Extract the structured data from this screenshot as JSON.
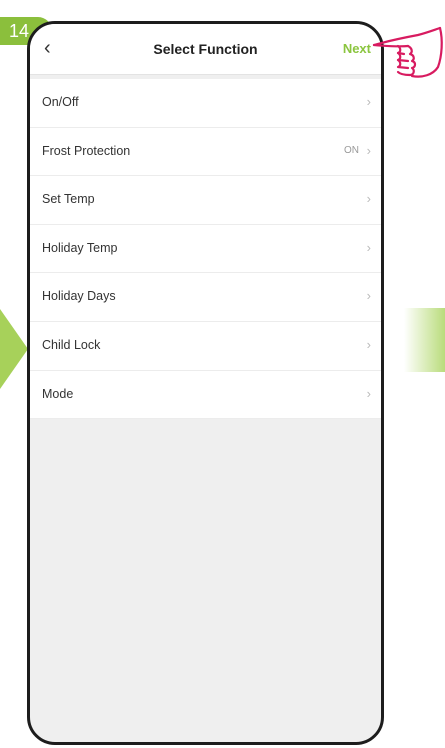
{
  "step_badge": "14",
  "header": {
    "title": "Select Function",
    "next_label": "Next"
  },
  "functions": [
    {
      "label": "On/Off",
      "value": ""
    },
    {
      "label": "Frost Protection",
      "value": "ON"
    },
    {
      "label": "Set Temp",
      "value": ""
    },
    {
      "label": "Holiday Temp",
      "value": ""
    },
    {
      "label": "Holiday Days",
      "value": ""
    },
    {
      "label": "Child Lock",
      "value": ""
    },
    {
      "label": "Mode",
      "value": ""
    }
  ],
  "colors": {
    "accent_green": "#8bc53f",
    "badge_green": "#8bbf3c",
    "hand_pink": "#d81b60"
  },
  "icons": [
    "back-arrow-icon",
    "chevron-right-icon",
    "pointing-hand-icon"
  ]
}
